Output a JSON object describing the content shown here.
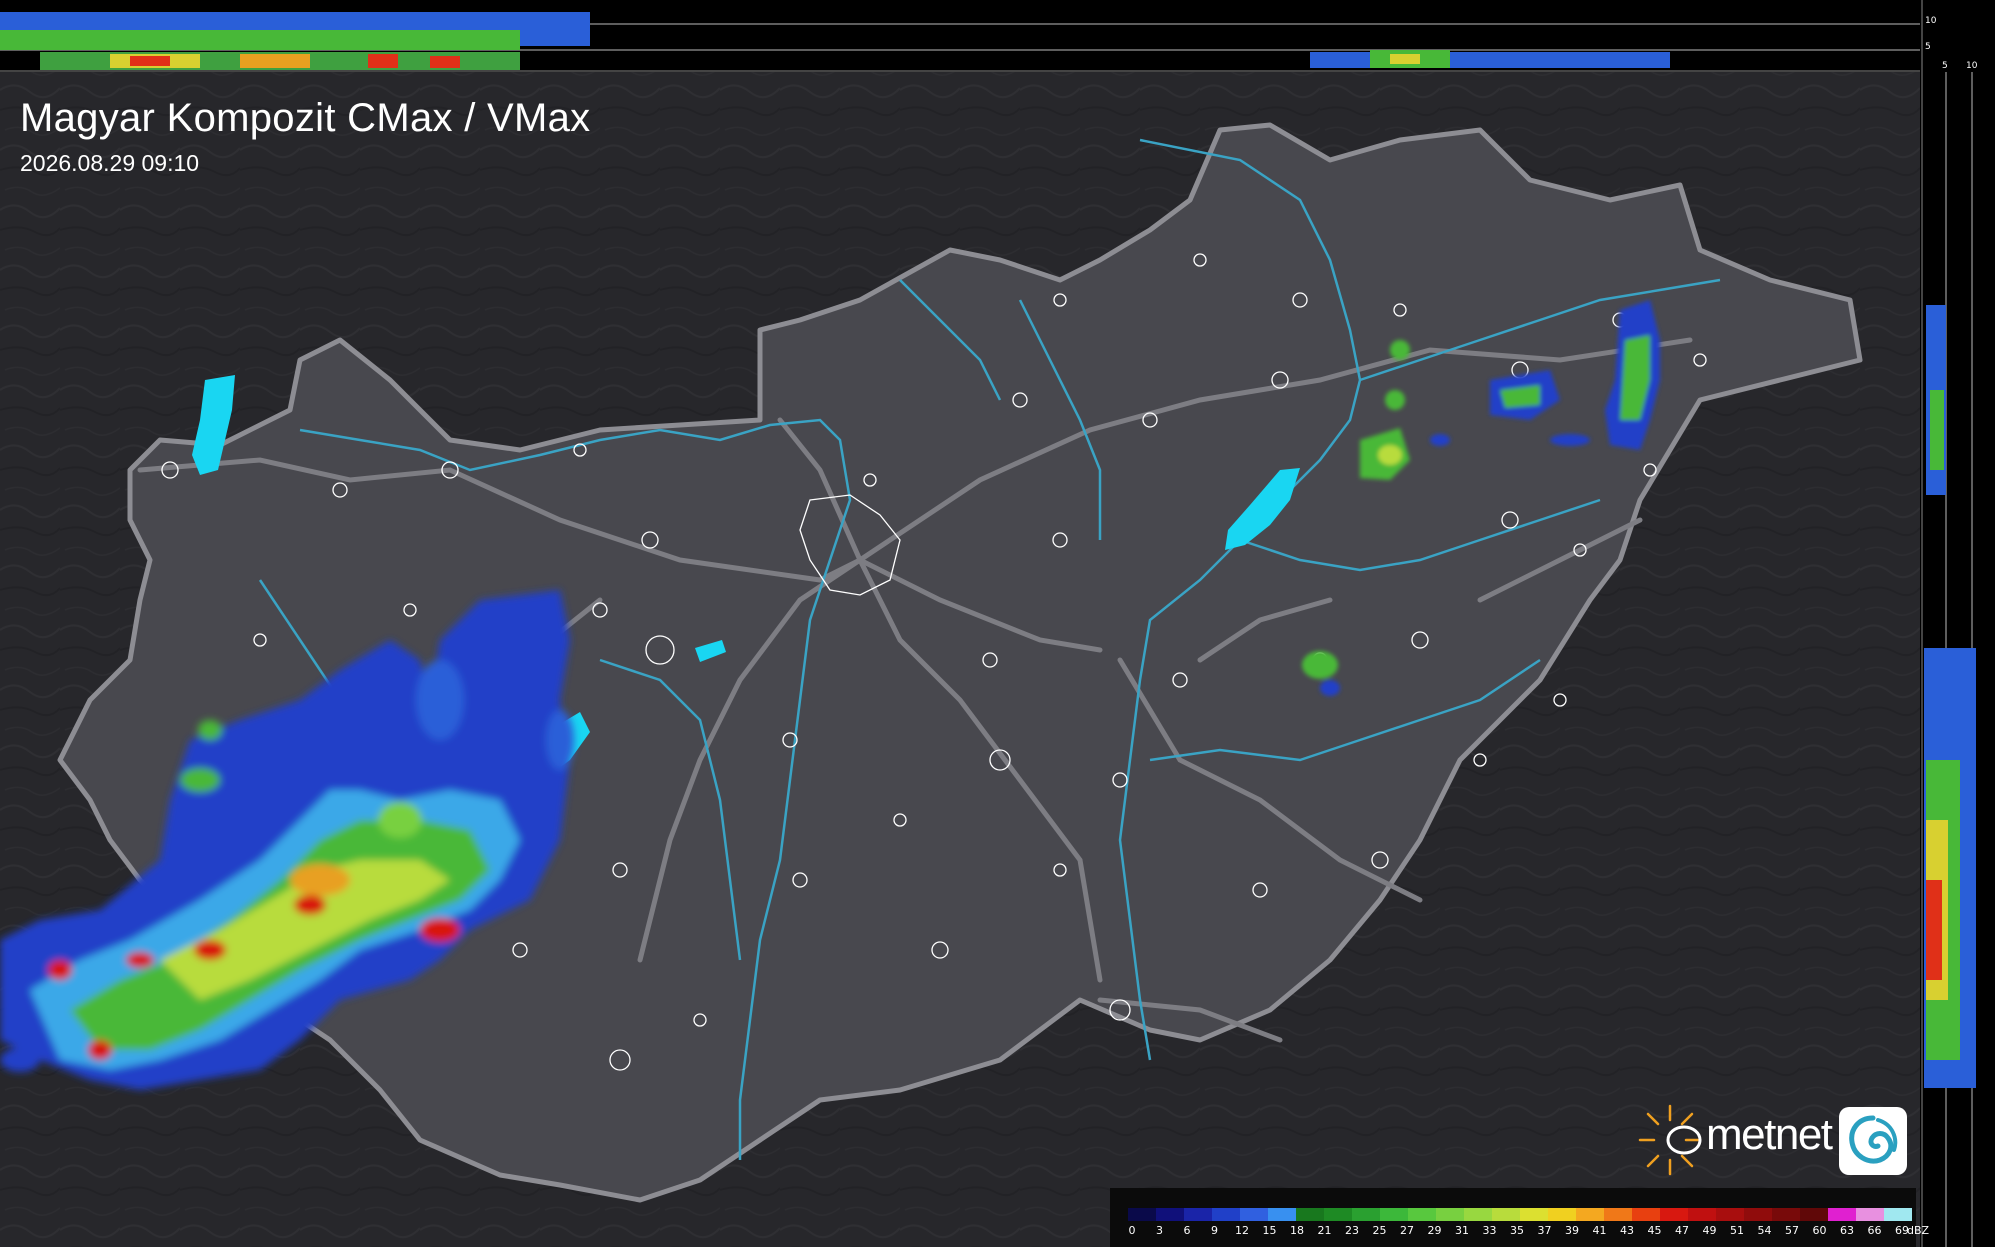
{
  "title": "Magyar Kompozit CMax / VMax",
  "timestamp": "2026.08.29 09:10",
  "top_profile_scale": [
    "10",
    "5"
  ],
  "side_profile_scale": [
    "5",
    "10"
  ],
  "logo": {
    "text": "metnet",
    "icon": "metnet-swirl-icon",
    "sun_icon": "sun-rays-icon"
  },
  "legend": {
    "unit": "dBZ",
    "labels": [
      "0",
      "3",
      "6",
      "9",
      "12",
      "15",
      "18",
      "21",
      "23",
      "25",
      "27",
      "29",
      "31",
      "33",
      "35",
      "37",
      "39",
      "41",
      "43",
      "45",
      "47",
      "49",
      "51",
      "54",
      "57",
      "60",
      "63",
      "66",
      "69"
    ],
    "colors": [
      "#0a0a4a",
      "#10107a",
      "#1a24a8",
      "#2040c8",
      "#3060e0",
      "#3890f0",
      "#18781e",
      "#1e8a24",
      "#2aa030",
      "#3cb83a",
      "#58c83e",
      "#78d040",
      "#98d840",
      "#b8dc3c",
      "#dce030",
      "#f0d020",
      "#f4a820",
      "#f07818",
      "#e84010",
      "#d81810",
      "#c01010",
      "#a80e0e",
      "#900c0c",
      "#780a0a",
      "#600808",
      "#e020d0",
      "#e890e0",
      "#a0e8f0"
    ]
  },
  "colors": {
    "land": "#2d2d31",
    "hungary_fill": "#4a4a50",
    "border": "#8a8a90",
    "roads": "#7c7c82",
    "rivers": "#3fa9c8",
    "lakes": "#19d6f2",
    "cities": "#ffffff"
  }
}
